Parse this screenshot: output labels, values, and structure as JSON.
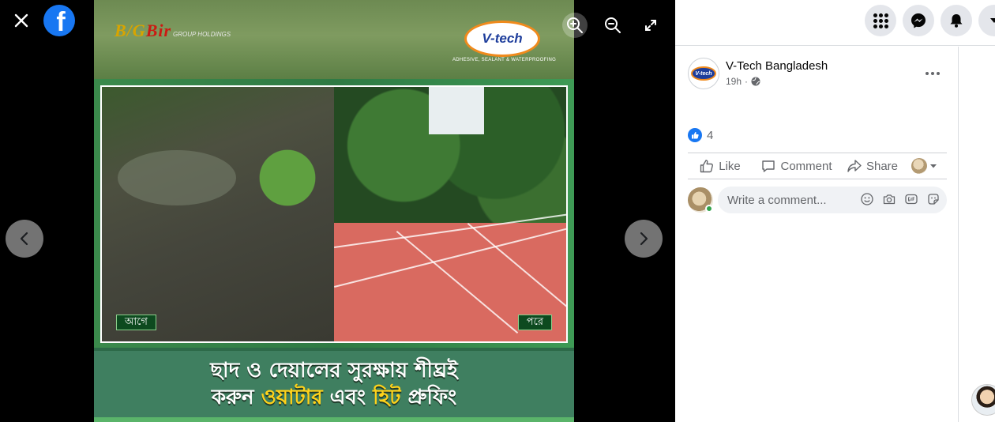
{
  "viewer": {
    "close_icon": "close-icon",
    "facebook_logo": "f",
    "zoom_in_icon": "zoom-in-icon",
    "zoom_out_icon": "zoom-out-icon",
    "fullscreen_icon": "fullscreen-icon",
    "prev_icon": "chevron-left-icon",
    "next_icon": "chevron-right-icon"
  },
  "photo": {
    "brand_left_prefix": "B/G",
    "brand_left_name": "Bir",
    "brand_left_sub": "GROUP HOLDINGS",
    "brand_right": "V-tech",
    "brand_right_tagline": "ADHESIVE, SEALANT & WATERPROOFING",
    "tag_before": "আগে",
    "tag_after": "পরে",
    "headline_line1": "ছাদ ও দেয়ালের সুরক্ষায় শীঘ্রই",
    "headline_line2_prefix": "করুন ",
    "headline_line2_highlight1": "ওয়াটার",
    "headline_line2_mid": " এবং ",
    "headline_line2_highlight2": "হিট",
    "headline_line2_suffix": " প্রুফিং"
  },
  "topbar": {
    "menu_icon": "grid-menu-icon",
    "messenger_icon": "messenger-icon",
    "notifications_icon": "bell-icon",
    "account_icon": "caret-down-icon"
  },
  "post": {
    "page_name": "V-Tech Bangladesh",
    "avatar_text": "V-tech",
    "time": "19h",
    "privacy_icon": "globe-icon",
    "reaction_count": "4",
    "like_label": "Like",
    "comment_label": "Comment",
    "share_label": "Share",
    "comment_placeholder": "Write a comment..."
  },
  "colors": {
    "facebook_blue": "#1877f2",
    "tag_bg": "#0d4a1f",
    "headline_highlight": "#ffd21a"
  }
}
